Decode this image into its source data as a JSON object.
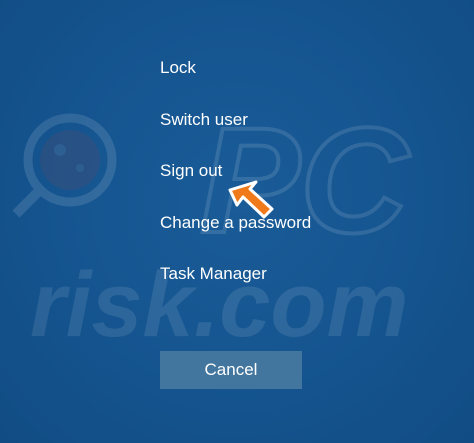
{
  "menu": {
    "items": [
      {
        "label": "Lock"
      },
      {
        "label": "Switch user"
      },
      {
        "label": "Sign out"
      },
      {
        "label": "Change a password"
      },
      {
        "label": "Task Manager"
      }
    ]
  },
  "dialog": {
    "cancel_label": "Cancel"
  },
  "watermark": {
    "text": "risk.com",
    "logo_text": "PC"
  },
  "colors": {
    "background": "#155590",
    "button": "#43769f",
    "text": "#ffffff",
    "arrow": "#f07a1a"
  },
  "annotation": {
    "icon": "arrow-pointer-icon"
  }
}
